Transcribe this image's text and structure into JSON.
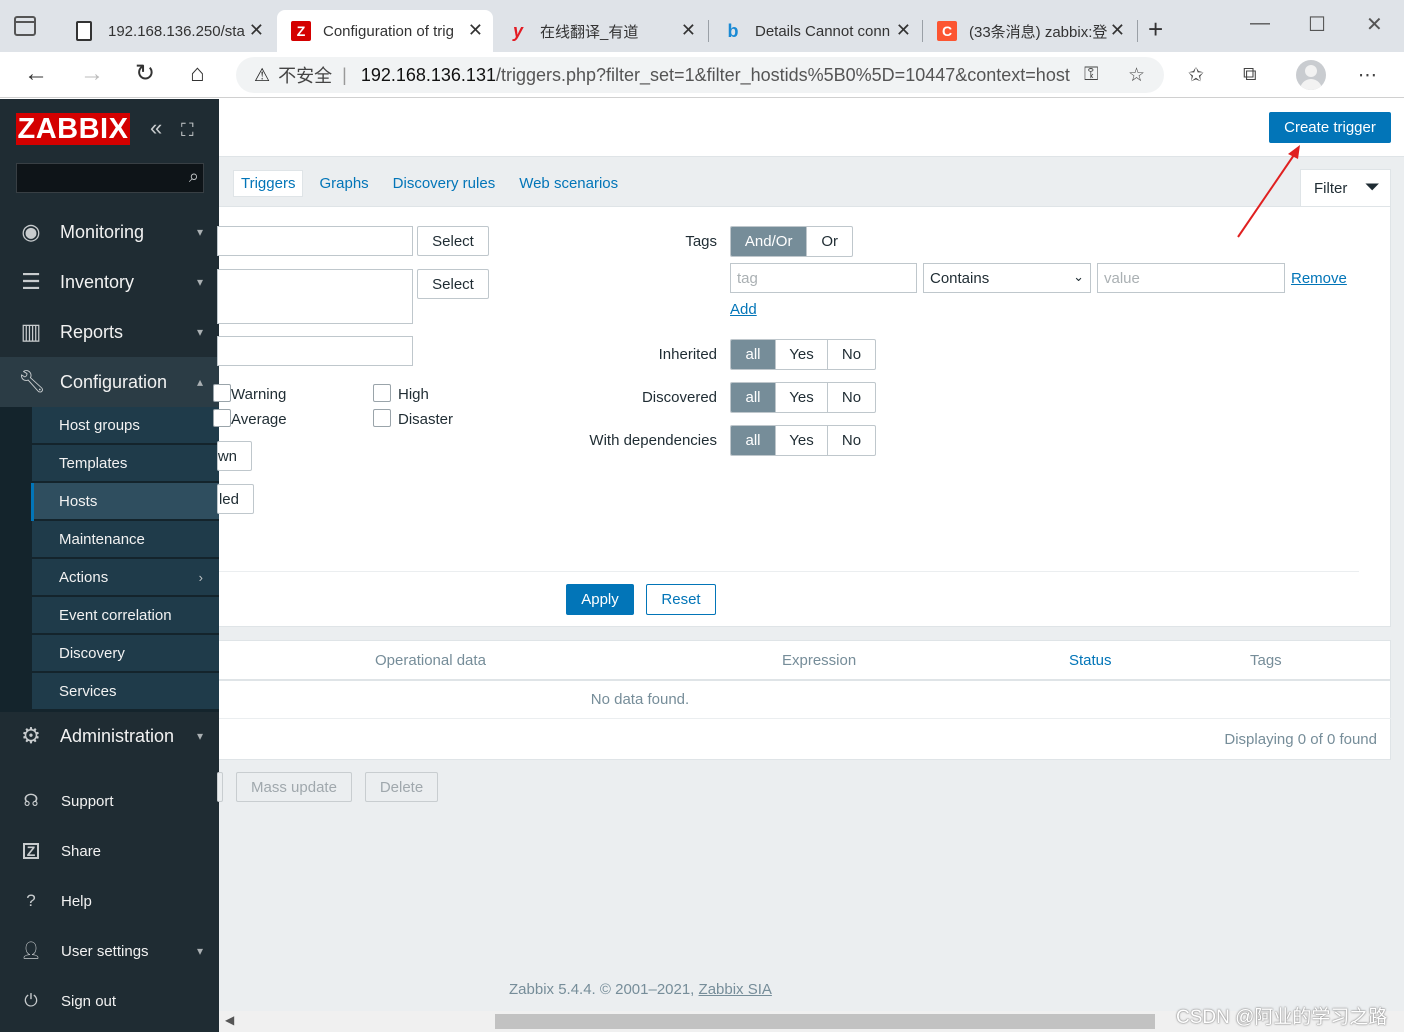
{
  "browser": {
    "tabs": [
      {
        "label": "192.168.136.250/sta",
        "icon": "page-icon"
      },
      {
        "label": "Configuration of trig",
        "icon": "zabbix-icon",
        "active": true
      },
      {
        "label": "在线翻译_有道",
        "icon": "youdao-icon"
      },
      {
        "label": "Details Cannot conn",
        "icon": "bing-icon"
      },
      {
        "label": "(33条消息) zabbix:登",
        "icon": "csdn-icon"
      }
    ],
    "insecure_label": "不安全",
    "url_host": "192.168.136.131",
    "url_path": "/triggers.php?filter_set=1&filter_hostids%5B0%5D=10447&context=host"
  },
  "sidebar": {
    "logo": "ZABBIX",
    "menu": [
      {
        "label": "Monitoring",
        "icon": "eye-icon"
      },
      {
        "label": "Inventory",
        "icon": "list-icon"
      },
      {
        "label": "Reports",
        "icon": "bar-chart-icon"
      },
      {
        "label": "Configuration",
        "icon": "wrench-icon"
      }
    ],
    "submenu": [
      "Host groups",
      "Templates",
      "Hosts",
      "Maintenance",
      "Actions",
      "Event correlation",
      "Discovery",
      "Services"
    ],
    "administration": "Administration",
    "lower": [
      {
        "label": "Support",
        "icon": "headset-icon"
      },
      {
        "label": "Share",
        "icon": "share-icon"
      },
      {
        "label": "Help",
        "icon": "help-icon"
      },
      {
        "label": "User settings",
        "icon": "user-icon"
      },
      {
        "label": "Sign out",
        "icon": "power-icon"
      }
    ]
  },
  "header": {
    "create_trigger": "Create trigger"
  },
  "subnav": [
    "Triggers",
    "Graphs",
    "Discovery rules",
    "Web scenarios"
  ],
  "filter": {
    "tab_label": "Filter",
    "select_1": "Select",
    "select_2": "Select",
    "severities": [
      "Warning",
      "Average",
      "High",
      "Disaster"
    ],
    "clipped_1": "wn",
    "clipped_2": "led",
    "tags_label": "Tags",
    "tags_mode": [
      "And/Or",
      "Or"
    ],
    "tag_placeholder": "tag",
    "operator": "Contains",
    "value_placeholder": "value",
    "remove": "Remove",
    "add": "Add",
    "inherited_label": "Inherited",
    "discovered_label": "Discovered",
    "dependencies_label": "With dependencies",
    "tri_state": [
      "all",
      "Yes",
      "No"
    ],
    "apply": "Apply",
    "reset": "Reset"
  },
  "table": {
    "columns": [
      "Operational data",
      "Expression",
      "Status",
      "Tags"
    ],
    "no_data": "No data found.",
    "paging": "Displaying 0 of 0 found"
  },
  "actions": {
    "mass_update": "Mass update",
    "delete": "Delete"
  },
  "footer": {
    "text": "Zabbix 5.4.4. © 2001–2021,",
    "link": "Zabbix SIA"
  },
  "watermark": "CSDN @阿业的学习之路",
  "colors": {
    "accent": "#0275b8",
    "sidebar": "#1f2c33",
    "logo_red": "#d40000",
    "annotation_arrow": "#e02020"
  }
}
